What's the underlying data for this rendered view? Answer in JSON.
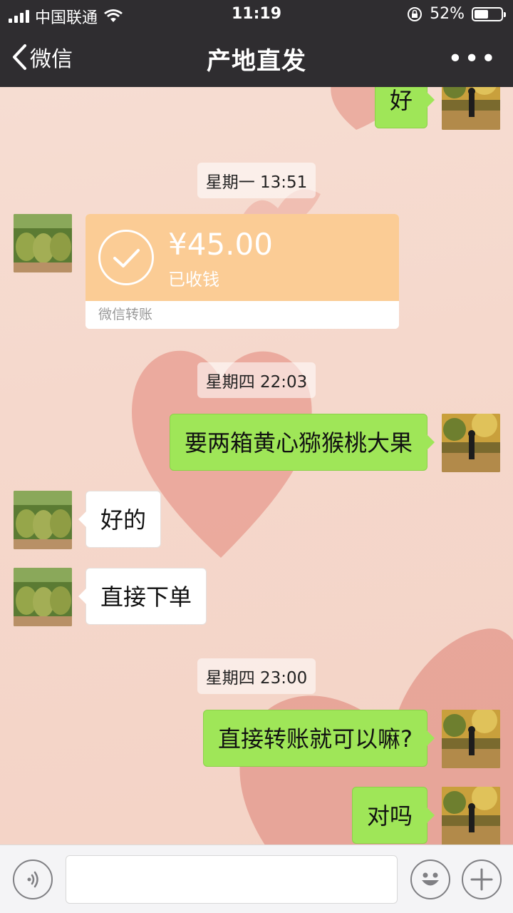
{
  "status_bar": {
    "carrier": "中国联通",
    "time": "11:19",
    "battery": "52%",
    "battery_level": 0.52
  },
  "nav": {
    "back_label": "微信",
    "title": "产地直发",
    "more_label": "•••"
  },
  "messages": [
    {
      "side": "right",
      "text": "好"
    },
    {
      "time": "星期一 13:51"
    },
    {
      "side": "left",
      "transfer": {
        "amount": "¥45.00",
        "status": "已收钱",
        "caption": "微信转账"
      }
    },
    {
      "time": "星期四 22:03"
    },
    {
      "side": "right",
      "text": "要两箱黄心猕猴桃大果"
    },
    {
      "side": "left",
      "text": "好的"
    },
    {
      "side": "left",
      "text": "直接下单"
    },
    {
      "time": "星期四 23:00"
    },
    {
      "side": "right",
      "text": "直接转账就可以嘛?"
    },
    {
      "side": "right",
      "text": "对吗"
    }
  ],
  "input_bar": {
    "voice_icon": "voice-icon",
    "emoji_icon": "emoji-icon",
    "add_icon": "plus-icon",
    "input_value": ""
  },
  "colors": {
    "nav_bg": "#2f2d30",
    "sent_bubble": "#9fe658",
    "received_bubble": "#ffffff",
    "transfer_card": "#fbcc95"
  }
}
